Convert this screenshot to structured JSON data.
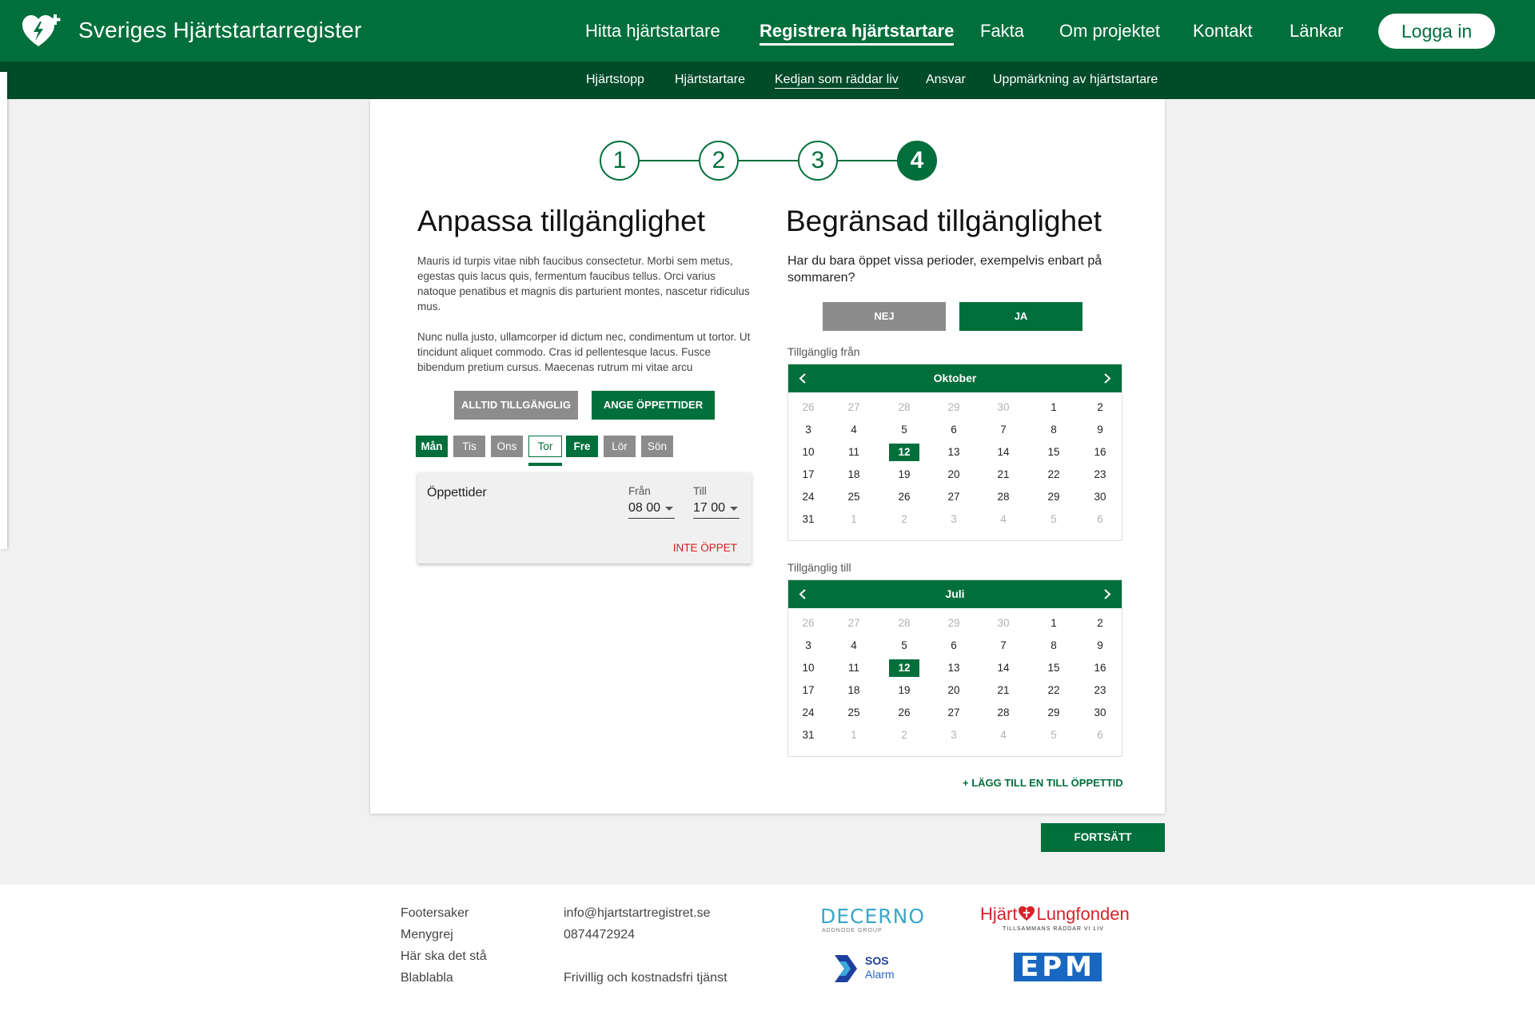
{
  "header": {
    "brand": "Sveriges Hjärtstartarregister",
    "nav": [
      "Hitta hjärtstartare",
      "Registrera hjärtstartare",
      "Fakta",
      "Om projektet",
      "Kontakt",
      "Länkar"
    ],
    "active_nav": "Registrera hjärtstartare",
    "login": "Logga in"
  },
  "subnav": {
    "items": [
      "Hjärtstopp",
      "Hjärtstartare",
      "Kedjan som räddar liv",
      "Ansvar",
      "Uppmärkning av hjärtstartare"
    ],
    "active": "Kedjan som räddar liv"
  },
  "stepper": {
    "steps": [
      "1",
      "2",
      "3",
      "4"
    ],
    "current": "4"
  },
  "left": {
    "title": "Anpassa tillgänglighet",
    "para1": "Mauris id turpis vitae nibh faucibus consectetur. Morbi sem metus, egestas quis lacus quis, fermentum faucibus tellus. Orci varius natoque penatibus et magnis dis parturient montes, nascetur ridiculus mus.",
    "para2": "Nunc nulla justo, ullamcorper id dictum nec, condimentum ut tortor. Ut tincidunt aliquet commodo. Cras id pellentesque lacus. Fusce bibendum pretium cursus. Maecenas rutrum mi vitae arcu",
    "always_btn": "ALLTID TILLGÄNGLIG",
    "hours_btn": "ANGE ÖPPETTIDER",
    "days": [
      {
        "label": "Mån",
        "state": "on"
      },
      {
        "label": "Tis",
        "state": "off"
      },
      {
        "label": "Ons",
        "state": "off"
      },
      {
        "label": "Tor",
        "state": "selected"
      },
      {
        "label": "Fre",
        "state": "on"
      },
      {
        "label": "Lör",
        "state": "off"
      },
      {
        "label": "Sön",
        "state": "off"
      }
    ],
    "hours": {
      "title": "Öppettider",
      "from_label": "Från",
      "from_value": "08 00",
      "to_label": "Till",
      "to_value": "17 00",
      "not_open": "INTE ÖPPET"
    }
  },
  "right": {
    "title": "Begränsad tillgänglighet",
    "question": "Har du bara öppet vissa perioder, exempelvis enbart på sommaren?",
    "no_btn": "NEJ",
    "yes_btn": "JA",
    "from_label": "Tillgänglig från",
    "to_label": "Tillgänglig till",
    "calendars": [
      {
        "month": "Oktober",
        "selected": "12",
        "rows": [
          [
            [
              "26",
              1
            ],
            [
              "27",
              1
            ],
            [
              "28",
              1
            ],
            [
              "29",
              1
            ],
            [
              "30",
              1
            ],
            [
              "1",
              0
            ],
            [
              "2",
              0
            ]
          ],
          [
            [
              "3",
              0
            ],
            [
              "4",
              0
            ],
            [
              "5",
              0
            ],
            [
              "6",
              0
            ],
            [
              "7",
              0
            ],
            [
              "8",
              0
            ],
            [
              "9",
              0
            ]
          ],
          [
            [
              "10",
              0
            ],
            [
              "11",
              0
            ],
            [
              "12",
              0
            ],
            [
              "13",
              0
            ],
            [
              "14",
              0
            ],
            [
              "15",
              0
            ],
            [
              "16",
              0
            ]
          ],
          [
            [
              "17",
              0
            ],
            [
              "18",
              0
            ],
            [
              "19",
              0
            ],
            [
              "20",
              0
            ],
            [
              "21",
              0
            ],
            [
              "22",
              0
            ],
            [
              "23",
              0
            ]
          ],
          [
            [
              "24",
              0
            ],
            [
              "25",
              0
            ],
            [
              "26",
              0
            ],
            [
              "27",
              0
            ],
            [
              "28",
              0
            ],
            [
              "29",
              0
            ],
            [
              "30",
              0
            ]
          ],
          [
            [
              "31",
              0
            ],
            [
              "1",
              1
            ],
            [
              "2",
              1
            ],
            [
              "3",
              1
            ],
            [
              "4",
              1
            ],
            [
              "5",
              1
            ],
            [
              "6",
              1
            ]
          ]
        ]
      },
      {
        "month": "Juli",
        "selected": "12",
        "rows": [
          [
            [
              "26",
              1
            ],
            [
              "27",
              1
            ],
            [
              "28",
              1
            ],
            [
              "29",
              1
            ],
            [
              "30",
              1
            ],
            [
              "1",
              0
            ],
            [
              "2",
              0
            ]
          ],
          [
            [
              "3",
              0
            ],
            [
              "4",
              0
            ],
            [
              "5",
              0
            ],
            [
              "6",
              0
            ],
            [
              "7",
              0
            ],
            [
              "8",
              0
            ],
            [
              "9",
              0
            ]
          ],
          [
            [
              "10",
              0
            ],
            [
              "11",
              0
            ],
            [
              "12",
              0
            ],
            [
              "13",
              0
            ],
            [
              "14",
              0
            ],
            [
              "15",
              0
            ],
            [
              "16",
              0
            ]
          ],
          [
            [
              "17",
              0
            ],
            [
              "18",
              0
            ],
            [
              "19",
              0
            ],
            [
              "20",
              0
            ],
            [
              "21",
              0
            ],
            [
              "22",
              0
            ],
            [
              "23",
              0
            ]
          ],
          [
            [
              "24",
              0
            ],
            [
              "25",
              0
            ],
            [
              "26",
              0
            ],
            [
              "27",
              0
            ],
            [
              "28",
              0
            ],
            [
              "29",
              0
            ],
            [
              "30",
              0
            ]
          ],
          [
            [
              "31",
              0
            ],
            [
              "1",
              1
            ],
            [
              "2",
              1
            ],
            [
              "3",
              1
            ],
            [
              "4",
              1
            ],
            [
              "5",
              1
            ],
            [
              "6",
              1
            ]
          ]
        ]
      }
    ],
    "add_time": "+ LÄGG TILL EN TILL ÖPPETTID"
  },
  "continue": "FORTSÄTT",
  "footer": {
    "links": [
      "Footersaker",
      "Menygrej",
      "Här ska det stå",
      "Blablabla"
    ],
    "email": "info@hjartstartregistret.se",
    "phone": "0874472924",
    "tagline": "Frivillig och kostnadsfri tjänst",
    "partners": {
      "decerno": "DECERNO",
      "decerno_sub": "ADDNODE GROUP",
      "hlf_a": "Hjärt",
      "hlf_b": "Lungfonden",
      "hlf_sub": "TILLSAMMANS RÄDDAR VI LIV",
      "sos_a": "SOS",
      "sos_b": "Alarm",
      "epm": "EPM"
    }
  },
  "colors": {
    "primary": "#006f3c",
    "dark": "#004b28",
    "grey_button": "#8c8c8c",
    "danger": "#d21f1f"
  }
}
